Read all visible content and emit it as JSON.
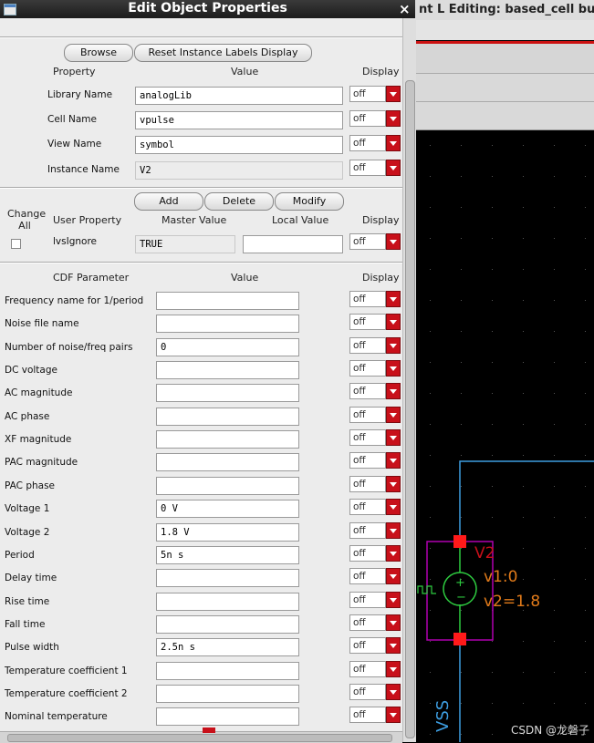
{
  "dialog": {
    "title": "Edit Object Properties",
    "buttons": {
      "browse": "Browse",
      "reset": "Reset Instance Labels Display",
      "add": "Add",
      "delete": "Delete",
      "modify": "Modify"
    },
    "headers": {
      "property": "Property",
      "value": "Value",
      "display": "Display",
      "change_all": "Change\nAll",
      "user_property": "User Property",
      "master_value": "Master Value",
      "local_value": "Local Value",
      "cdf_parameter": "CDF Parameter"
    },
    "properties": [
      {
        "label": "Library Name",
        "value": "analogLib",
        "display": "off"
      },
      {
        "label": "Cell Name",
        "value": "vpulse",
        "display": "off"
      },
      {
        "label": "View Name",
        "value": "symbol",
        "display": "off"
      },
      {
        "label": "Instance Name",
        "value": "V2",
        "display": "off"
      }
    ],
    "user_property": {
      "label": "lvsIgnore",
      "master_value": "TRUE",
      "local_value": "",
      "display": "off"
    },
    "cdf_parameters": [
      {
        "label": "Frequency name for 1/period",
        "value": "",
        "display": "off"
      },
      {
        "label": "Noise file name",
        "value": "",
        "display": "off"
      },
      {
        "label": "Number of noise/freq pairs",
        "value": "0",
        "display": "off"
      },
      {
        "label": "DC voltage",
        "value": "",
        "display": "off"
      },
      {
        "label": "AC magnitude",
        "value": "",
        "display": "off"
      },
      {
        "label": "AC phase",
        "value": "",
        "display": "off"
      },
      {
        "label": "XF magnitude",
        "value": "",
        "display": "off"
      },
      {
        "label": "PAC magnitude",
        "value": "",
        "display": "off"
      },
      {
        "label": "PAC phase",
        "value": "",
        "display": "off"
      },
      {
        "label": "Voltage 1",
        "value": "0 V",
        "display": "off"
      },
      {
        "label": "Voltage 2",
        "value": "1.8 V",
        "display": "off"
      },
      {
        "label": "Period",
        "value": "5n s",
        "display": "off"
      },
      {
        "label": "Delay time",
        "value": "",
        "display": "off"
      },
      {
        "label": "Rise time",
        "value": "",
        "display": "off"
      },
      {
        "label": "Fall time",
        "value": "",
        "display": "off"
      },
      {
        "label": "Pulse width",
        "value": "2.5n s",
        "display": "off"
      },
      {
        "label": "Temperature coefficient 1",
        "value": "",
        "display": "off"
      },
      {
        "label": "Temperature coefficient 2",
        "value": "",
        "display": "off"
      },
      {
        "label": "Nominal temperature",
        "value": "",
        "display": "off"
      }
    ]
  },
  "background": {
    "title": "nt L Editing: based_cell buf",
    "schematic": {
      "instance_name": "V2",
      "param1": "v1:0",
      "param2": "v2=1.8",
      "net_label": "VSS"
    }
  },
  "watermark": "CSDN @龙磐子",
  "colors": {
    "accent_red": "#c8101a",
    "instance_magenta": "#b000b0",
    "wire_blue": "#3d9de0",
    "symbol_green": "#2ecc40",
    "label_orange": "#e07a1a"
  }
}
